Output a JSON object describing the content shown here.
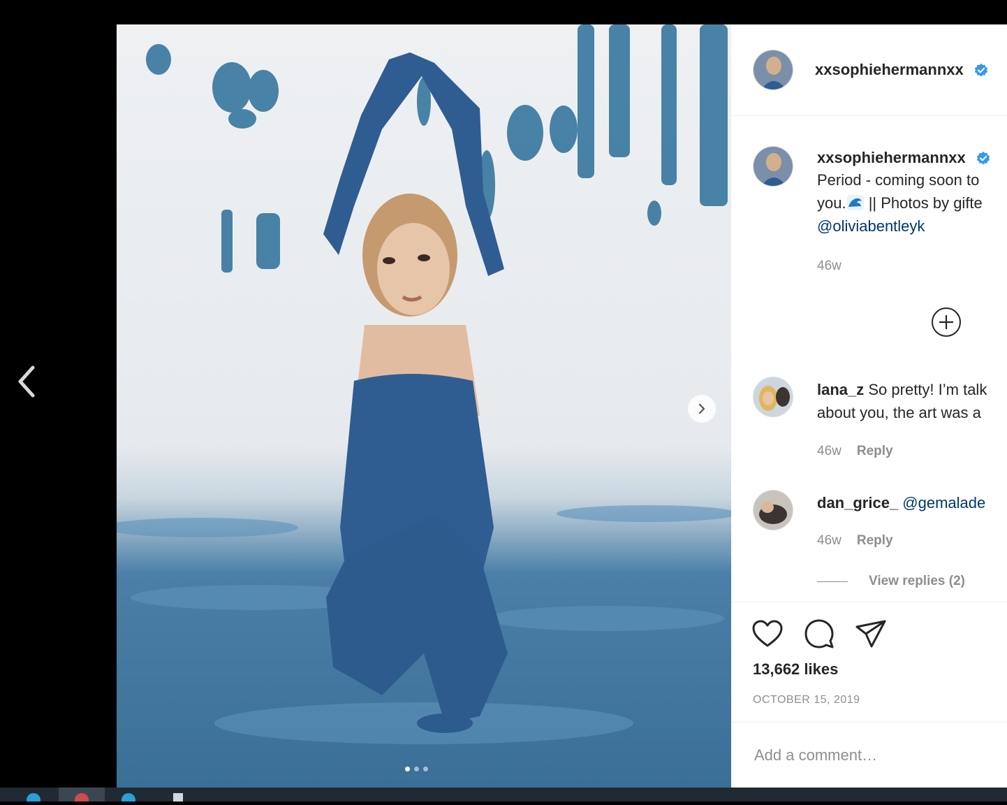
{
  "post": {
    "author": "xxsophiehermannxx",
    "image_alt": "",
    "carousel": {
      "total": 3,
      "active": 0
    }
  },
  "caption": {
    "username": "xxsophiehermannxx",
    "line1": "Period - coming soon to",
    "line2_text": "you.",
    "line2_rest": " || Photos by gifte",
    "mention": "@oliviabentleyk",
    "time": "46w"
  },
  "comments": [
    {
      "username": "lana_z",
      "text1": " So pretty! I’m talk",
      "text2": "about you, the art was a",
      "time": "46w",
      "reply": "Reply"
    },
    {
      "username": "dan_grice_",
      "mention": "@gemalade",
      "time": "46w",
      "reply": "Reply",
      "view_replies": "View replies (2)"
    }
  ],
  "actions": {
    "likes": "13,662 likes",
    "date": "OCTOBER 15, 2019"
  },
  "composer": {
    "placeholder": "Add a comment…"
  },
  "colors": {
    "verified": "#3897f0",
    "link": "#00376b",
    "muted": "#8e8e8e",
    "text": "#262626"
  },
  "icons": [
    "chevron-left-icon",
    "chevron-right-icon",
    "verified-badge-icon",
    "plus-circle-icon",
    "heart-icon",
    "comment-icon",
    "share-icon"
  ]
}
